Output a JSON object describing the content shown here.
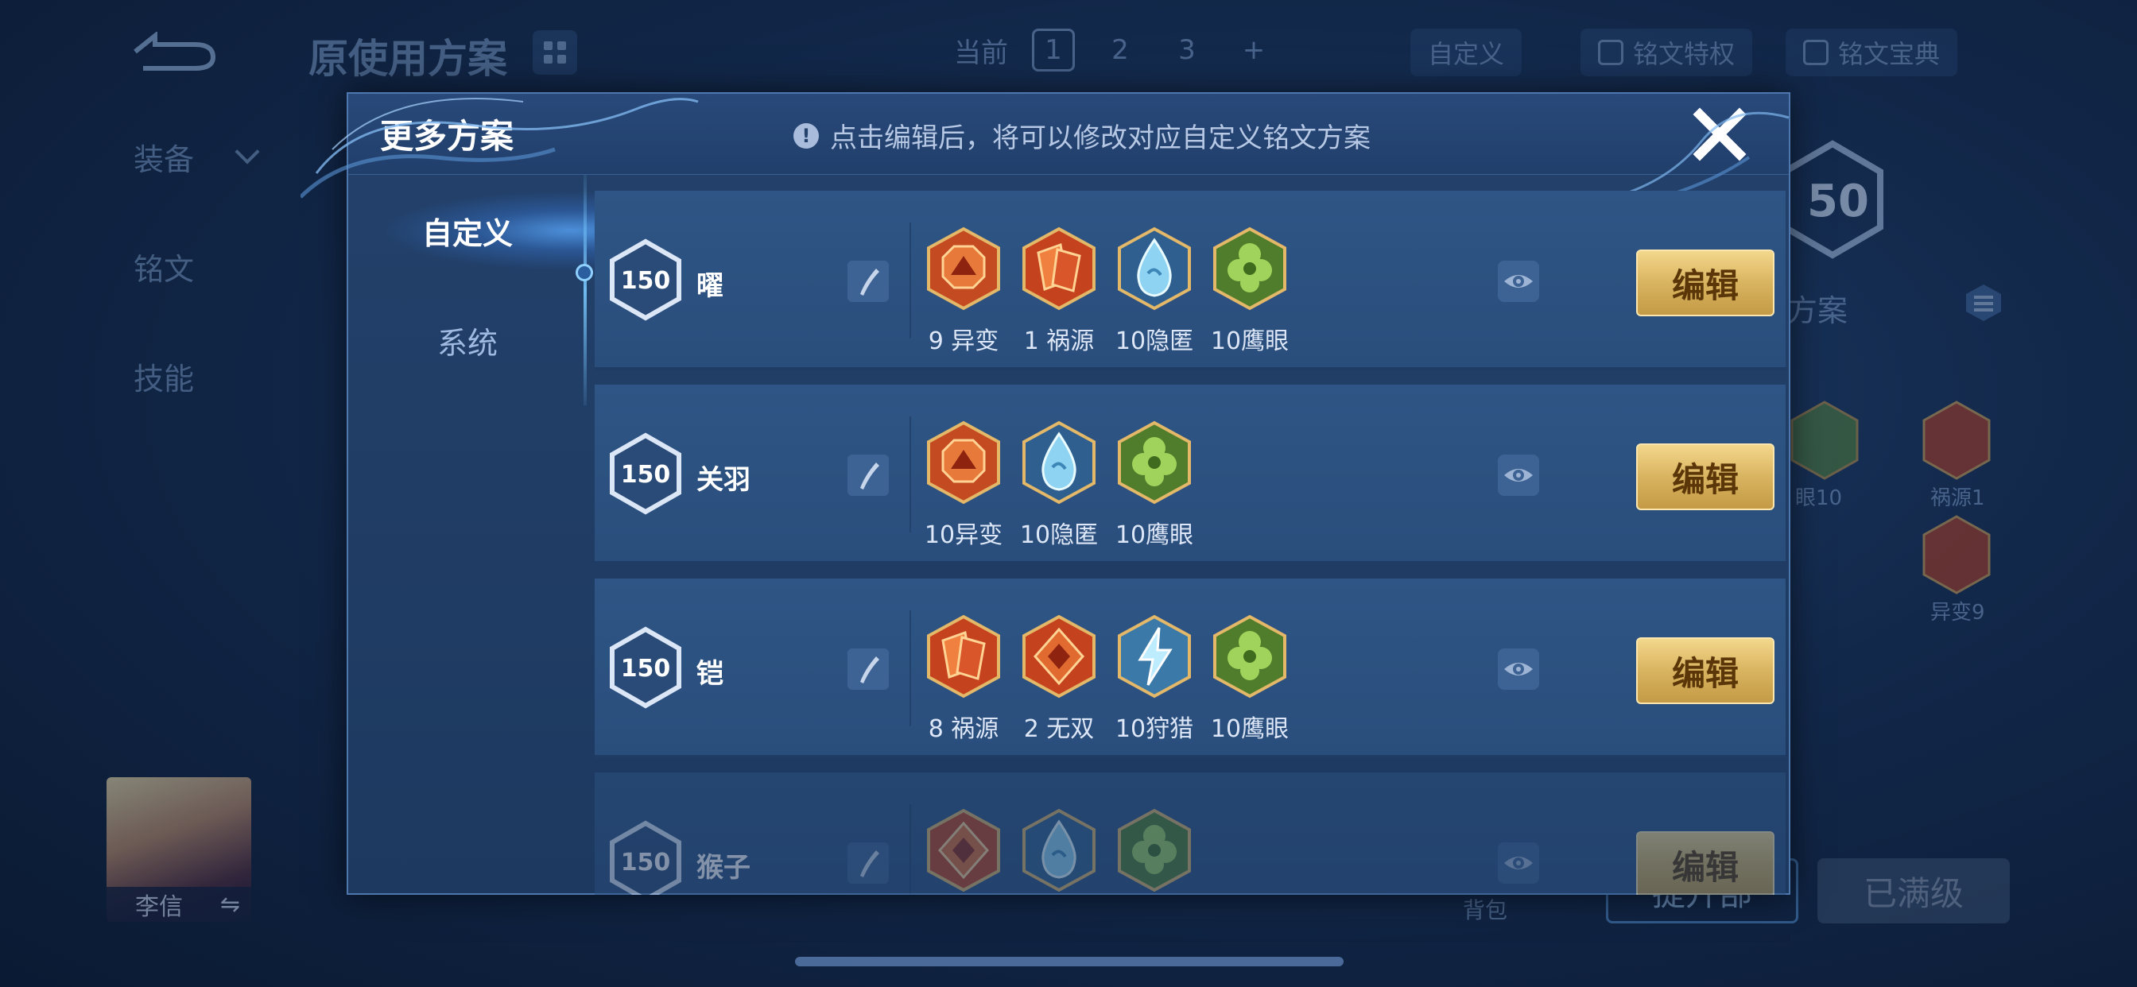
{
  "background": {
    "title": "原使用方案",
    "tabs": {
      "current_label": "当前",
      "pages": [
        "1",
        "2",
        "3"
      ],
      "add": "+"
    },
    "pills": [
      "自定义",
      "铭文特权",
      "铭文宝典"
    ],
    "left_menu": [
      "装备",
      "铭文",
      "技能"
    ],
    "hero_name": "李信",
    "swap_icon": "⇋",
    "right_level": "50",
    "right_text": "用方案",
    "gem_labels": [
      "眼10",
      "祸源1",
      "异变9"
    ],
    "bag_label": "背包",
    "upgrade_button": "提升部",
    "maxed_button": "已满级"
  },
  "modal": {
    "title": "更多方案",
    "notice_icon": "!",
    "notice": "点击编辑后，将可以修改对应自定义铭文方案",
    "close_icon": "close-icon",
    "sidebar": [
      {
        "label": "自定义",
        "active": true
      },
      {
        "label": "系统",
        "active": false
      }
    ],
    "rows": [
      {
        "level": "150",
        "name": "曜",
        "gems": [
          {
            "label": "9 异变",
            "type": "red-octagon"
          },
          {
            "label": "1 祸源",
            "type": "red-cards"
          },
          {
            "label": "10隐匿",
            "type": "blue-drop"
          },
          {
            "label": "10鹰眼",
            "type": "green-clover"
          }
        ],
        "edit_label": "编辑"
      },
      {
        "level": "150",
        "name": "关羽",
        "gems": [
          {
            "label": "10异变",
            "type": "red-octagon"
          },
          {
            "label": "10隐匿",
            "type": "blue-drop"
          },
          {
            "label": "10鹰眼",
            "type": "green-clover"
          }
        ],
        "edit_label": "编辑"
      },
      {
        "level": "150",
        "name": "铠",
        "gems": [
          {
            "label": "8 祸源",
            "type": "red-cards"
          },
          {
            "label": "2 无双",
            "type": "red-diamond"
          },
          {
            "label": "10狩猎",
            "type": "blue-bolt"
          },
          {
            "label": "10鹰眼",
            "type": "green-clover"
          }
        ],
        "edit_label": "编辑"
      },
      {
        "level": "150",
        "name": "猴子",
        "gems": [
          {
            "label": "",
            "type": "red-diamond"
          },
          {
            "label": "",
            "type": "blue-drop"
          },
          {
            "label": "",
            "type": "green-clover"
          }
        ],
        "edit_label": "编辑"
      }
    ]
  }
}
